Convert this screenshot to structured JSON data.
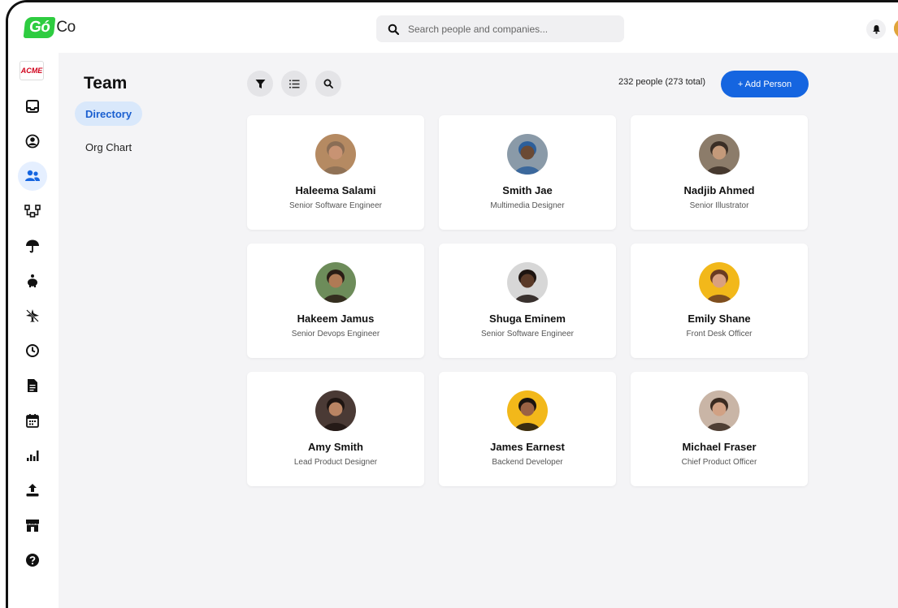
{
  "app": {
    "logo_go": "Gó",
    "logo_co": "Co"
  },
  "search": {
    "placeholder": "Search people and companies..."
  },
  "company_badge": "ACME",
  "rail": {
    "items": [
      {
        "icon": "inbox-icon",
        "active": false
      },
      {
        "icon": "user-circle-icon",
        "active": false
      },
      {
        "icon": "team-icon",
        "active": true
      },
      {
        "icon": "org-icon",
        "active": false
      },
      {
        "icon": "umbrella-icon",
        "active": false
      },
      {
        "icon": "piggy-bank-icon",
        "active": false
      },
      {
        "icon": "airplane-off-icon",
        "active": false
      },
      {
        "icon": "clock-icon",
        "active": false
      },
      {
        "icon": "document-icon",
        "active": false
      },
      {
        "icon": "calendar-icon",
        "active": false
      },
      {
        "icon": "bar-chart-icon",
        "active": false
      },
      {
        "icon": "upload-icon",
        "active": false
      },
      {
        "icon": "store-icon",
        "active": false
      },
      {
        "icon": "help-icon",
        "active": false
      }
    ]
  },
  "subnav": {
    "title": "Team",
    "items": [
      {
        "label": "Directory",
        "active": true
      },
      {
        "label": "Org Chart",
        "active": false
      }
    ]
  },
  "toolbar": {
    "count_text": "232 people (273 total)",
    "add_label": "+ Add Person"
  },
  "people": [
    {
      "name": "Haleema Salami",
      "role": "Senior Software Engineer",
      "bg": "#b58a62",
      "skin": "#c89373",
      "hair": "#8a6d55"
    },
    {
      "name": "Smith Jae",
      "role": "Multimedia Designer",
      "bg": "#8a9aa8",
      "skin": "#6b4a34",
      "hair": "#2d5f9a"
    },
    {
      "name": "Nadjib Ahmed",
      "role": "Senior Illustrator",
      "bg": "#8c7c6a",
      "skin": "#c49a7a",
      "hair": "#3a2e25"
    },
    {
      "name": "Hakeem Jamus",
      "role": "Senior Devops Engineer",
      "bg": "#6d8c5a",
      "skin": "#b07a55",
      "hair": "#2a1d15"
    },
    {
      "name": "Shuga Eminem",
      "role": "Senior Software Engineer",
      "bg": "#d7d7d7",
      "skin": "#5a3a28",
      "hair": "#1d1410"
    },
    {
      "name": "Emily Shane",
      "role": "Front Desk Officer",
      "bg": "#f2b81a",
      "skin": "#d9a07f",
      "hair": "#6a3b22"
    },
    {
      "name": "Amy Smith",
      "role": "Lead Product Designer",
      "bg": "#4a3a35",
      "skin": "#b98463",
      "hair": "#1e1512"
    },
    {
      "name": "James Earnest",
      "role": "Backend Developer",
      "bg": "#f2b81a",
      "skin": "#9a6244",
      "hair": "#1a1410"
    },
    {
      "name": "Michael Fraser",
      "role": "Chief Product Officer",
      "bg": "#c9b5a6",
      "skin": "#d1a184",
      "hair": "#3a2a20"
    }
  ]
}
